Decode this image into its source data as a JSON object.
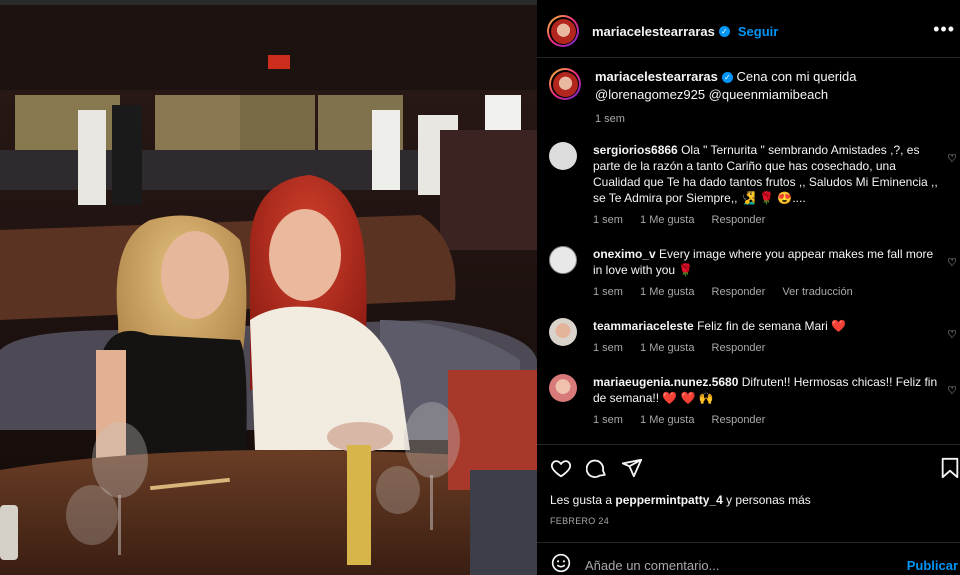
{
  "header": {
    "username": "mariacelestearraras",
    "follow_label": "Seguir",
    "more_label": "•••"
  },
  "caption": {
    "username": "mariacelestearraras",
    "text": "Cena con mi querida @lorenagomez925 @queenmiamibeach",
    "time": "1 sem"
  },
  "comments": [
    {
      "username": "sergiorios6866",
      "text": "Ola \" Ternurita \" sembrando Amistades ,?, es parte de la razón a tanto Cariño que has cosechado, una Cualidad que Te ha dado tantos frutos ,, Saludos Mi Eminencia ,, se Te Admira por Siempre,, 🧏‍♂️ 🌹 😍....",
      "time": "1 sem",
      "likes": "1 Me gusta",
      "reply": "Responder",
      "translate": ""
    },
    {
      "username": "oneximo_v",
      "text": "Every image where you appear makes me fall more in love with you 🌹",
      "time": "1 sem",
      "likes": "1 Me gusta",
      "reply": "Responder",
      "translate": "Ver traducción"
    },
    {
      "username": "teammariaceleste",
      "text": "Feliz fin de semana Mari ❤️",
      "time": "1 sem",
      "likes": "1 Me gusta",
      "reply": "Responder",
      "translate": ""
    },
    {
      "username": "mariaeugenia.nunez.5680",
      "text": "Difruten!! Hermosas chicas!! Feliz fin de semana!! ❤️ ❤️ 🙌",
      "time": "1 sem",
      "likes": "1 Me gusta",
      "reply": "Responder",
      "translate": ""
    }
  ],
  "actions": {
    "like_icon": "heart-icon",
    "comment_icon": "comment-icon",
    "share_icon": "share-icon",
    "save_icon": "bookmark-icon"
  },
  "likes": {
    "prefix": "Les gusta a ",
    "user": "peppermintpatty_4",
    "suffix": " y personas más"
  },
  "date": "FEBRERO 24",
  "add_comment": {
    "placeholder": "Añade un comentario...",
    "publish_label": "Publicar"
  },
  "colors": {
    "accent": "#0095f6",
    "background": "#000000",
    "secondary_text": "#a8a8a8",
    "divider": "#262626"
  }
}
